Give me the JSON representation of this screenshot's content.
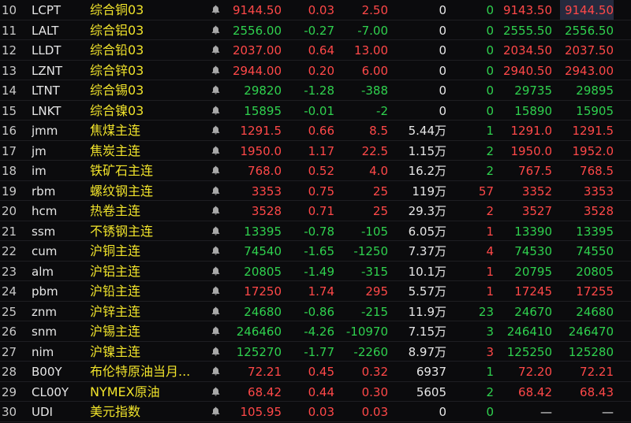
{
  "rows": [
    {
      "idx": "10",
      "code": "LCPT",
      "name": "综合铜03",
      "price": "9144.50",
      "chg_pct": "0.03",
      "chg": "2.50",
      "vol": "0",
      "qty": "0",
      "bid": "9143.50",
      "ask": "9144.50",
      "dir": "up",
      "highlight_ask": true
    },
    {
      "idx": "11",
      "code": "LALT",
      "name": "综合铝03",
      "price": "2556.00",
      "chg_pct": "-0.27",
      "chg": "-7.00",
      "vol": "0",
      "qty": "0",
      "bid": "2555.50",
      "ask": "2556.50",
      "dir": "down"
    },
    {
      "idx": "12",
      "code": "LLDT",
      "name": "综合铅03",
      "price": "2037.00",
      "chg_pct": "0.64",
      "chg": "13.00",
      "vol": "0",
      "qty": "0",
      "bid": "2034.50",
      "ask": "2037.50",
      "dir": "up"
    },
    {
      "idx": "13",
      "code": "LZNT",
      "name": "综合锌03",
      "price": "2944.00",
      "chg_pct": "0.20",
      "chg": "6.00",
      "vol": "0",
      "qty": "0",
      "bid": "2940.50",
      "ask": "2943.00",
      "dir": "up"
    },
    {
      "idx": "14",
      "code": "LTNT",
      "name": "综合锡03",
      "price": "29820",
      "chg_pct": "-1.28",
      "chg": "-388",
      "vol": "0",
      "qty": "0",
      "bid": "29735",
      "ask": "29895",
      "dir": "down"
    },
    {
      "idx": "15",
      "code": "LNKT",
      "name": "综合镍03",
      "price": "15895",
      "chg_pct": "-0.01",
      "chg": "-2",
      "vol": "0",
      "qty": "0",
      "bid": "15890",
      "ask": "15905",
      "dir": "down"
    },
    {
      "idx": "16",
      "code": "jmm",
      "name": "焦煤主连",
      "price": "1291.5",
      "chg_pct": "0.66",
      "chg": "8.5",
      "vol": "5.44万",
      "qty": "1",
      "bid": "1291.0",
      "ask": "1291.5",
      "dir": "up"
    },
    {
      "idx": "17",
      "code": "jm",
      "name": "焦炭主连",
      "price": "1950.0",
      "chg_pct": "1.17",
      "chg": "22.5",
      "vol": "1.15万",
      "qty": "2",
      "bid": "1950.0",
      "ask": "1952.0",
      "dir": "up"
    },
    {
      "idx": "18",
      "code": "im",
      "name": "铁矿石主连",
      "price": "768.0",
      "chg_pct": "0.52",
      "chg": "4.0",
      "vol": "16.2万",
      "qty": "2",
      "bid": "767.5",
      "ask": "768.5",
      "dir": "up"
    },
    {
      "idx": "19",
      "code": "rbm",
      "name": "螺纹钢主连",
      "price": "3353",
      "chg_pct": "0.75",
      "chg": "25",
      "vol": "119万",
      "qty": "57",
      "bid": "3352",
      "ask": "3353",
      "dir": "up",
      "qty_red": true
    },
    {
      "idx": "20",
      "code": "hcm",
      "name": "热卷主连",
      "price": "3528",
      "chg_pct": "0.71",
      "chg": "25",
      "vol": "29.3万",
      "qty": "2",
      "bid": "3527",
      "ask": "3528",
      "dir": "up",
      "qty_red": true
    },
    {
      "idx": "21",
      "code": "ssm",
      "name": "不锈钢主连",
      "price": "13395",
      "chg_pct": "-0.78",
      "chg": "-105",
      "vol": "6.05万",
      "qty": "1",
      "bid": "13390",
      "ask": "13395",
      "dir": "down",
      "qty_red": true
    },
    {
      "idx": "22",
      "code": "cum",
      "name": "沪铜主连",
      "price": "74540",
      "chg_pct": "-1.65",
      "chg": "-1250",
      "vol": "7.37万",
      "qty": "4",
      "bid": "74530",
      "ask": "74550",
      "dir": "down",
      "qty_red": true
    },
    {
      "idx": "23",
      "code": "alm",
      "name": "沪铝主连",
      "price": "20805",
      "chg_pct": "-1.49",
      "chg": "-315",
      "vol": "10.1万",
      "qty": "1",
      "bid": "20795",
      "ask": "20805",
      "dir": "down",
      "qty_red": true
    },
    {
      "idx": "24",
      "code": "pbm",
      "name": "沪铅主连",
      "price": "17250",
      "chg_pct": "1.74",
      "chg": "295",
      "vol": "5.57万",
      "qty": "1",
      "bid": "17245",
      "ask": "17255",
      "dir": "up",
      "qty_red": true
    },
    {
      "idx": "25",
      "code": "znm",
      "name": "沪锌主连",
      "price": "24680",
      "chg_pct": "-0.86",
      "chg": "-215",
      "vol": "11.9万",
      "qty": "23",
      "bid": "24670",
      "ask": "24680",
      "dir": "down"
    },
    {
      "idx": "26",
      "code": "snm",
      "name": "沪锡主连",
      "price": "246460",
      "chg_pct": "-4.26",
      "chg": "-10970",
      "vol": "7.15万",
      "qty": "3",
      "bid": "246410",
      "ask": "246470",
      "dir": "down"
    },
    {
      "idx": "27",
      "code": "nim",
      "name": "沪镍主连",
      "price": "125270",
      "chg_pct": "-1.77",
      "chg": "-2260",
      "vol": "8.97万",
      "qty": "3",
      "bid": "125250",
      "ask": "125280",
      "dir": "down",
      "qty_red": true
    },
    {
      "idx": "28",
      "code": "B00Y",
      "name": "布伦特原油当月...",
      "price": "72.21",
      "chg_pct": "0.45",
      "chg": "0.32",
      "vol": "6937",
      "qty": "1",
      "bid": "72.20",
      "ask": "72.21",
      "dir": "up"
    },
    {
      "idx": "29",
      "code": "CL00Y",
      "name": "NYMEX原油",
      "price": "68.42",
      "chg_pct": "0.44",
      "chg": "0.30",
      "vol": "5605",
      "qty": "2",
      "bid": "68.42",
      "ask": "68.43",
      "dir": "up"
    },
    {
      "idx": "30",
      "code": "UDI",
      "name": "美元指数",
      "price": "105.95",
      "chg_pct": "0.03",
      "chg": "0.03",
      "vol": "0",
      "qty": "0",
      "bid": "—",
      "ask": "—",
      "dir": "up",
      "dash": true
    }
  ],
  "colors": {
    "up": "#ff4848",
    "down": "#2fd14e",
    "name": "#f0e32b",
    "highlight": "#262a3e"
  },
  "icons": {
    "alert": "bell-icon"
  }
}
